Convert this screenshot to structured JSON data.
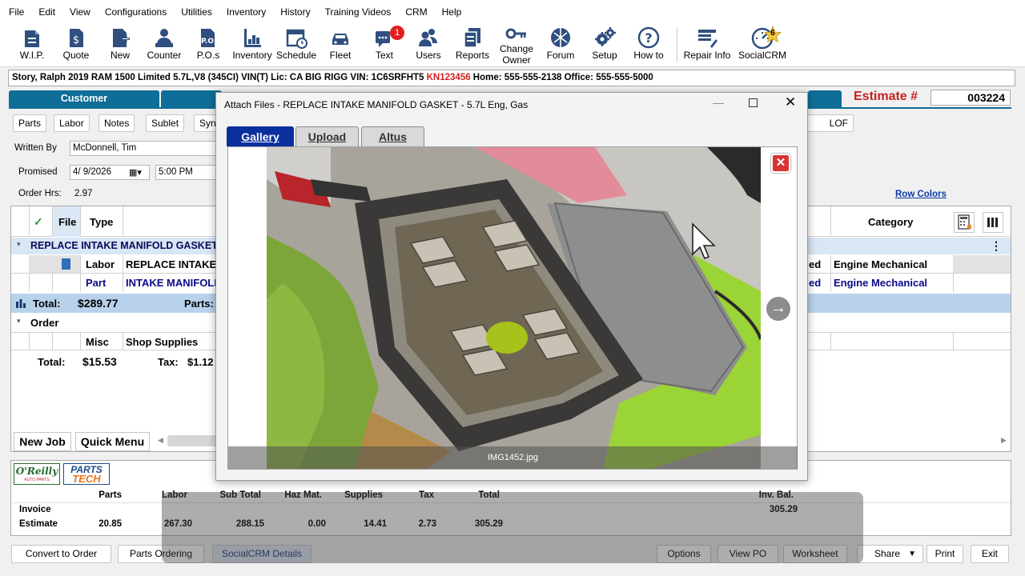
{
  "menu": [
    "File",
    "Edit",
    "View",
    "Configurations",
    "Utilities",
    "Inventory",
    "History",
    "Training Videos",
    "CRM",
    "Help"
  ],
  "toolbar": {
    "items": [
      {
        "label": "W.I.P.",
        "icon": "wip-icon"
      },
      {
        "label": "Quote",
        "icon": "quote-icon"
      },
      {
        "label": "New",
        "icon": "new-icon"
      },
      {
        "label": "Counter",
        "icon": "counter-icon"
      },
      {
        "label": "P.O.s",
        "icon": "po-icon"
      },
      {
        "label": "Inventory",
        "icon": "inventory-icon"
      },
      {
        "label": "Schedule",
        "icon": "schedule-icon"
      },
      {
        "label": "Fleet",
        "icon": "fleet-icon"
      },
      {
        "label": "Text",
        "icon": "text-icon"
      },
      {
        "label": "Users",
        "icon": "users-icon"
      },
      {
        "label": "Reports",
        "icon": "reports-icon"
      },
      {
        "label": "Change",
        "label2": "Owner",
        "icon": "change-owner-icon"
      },
      {
        "label": "Forum",
        "icon": "forum-icon"
      },
      {
        "label": "Setup",
        "icon": "setup-icon"
      },
      {
        "label": "How to",
        "icon": "how-to-icon"
      },
      {
        "label": "Repair Info",
        "icon": "repair-info-icon"
      },
      {
        "label": "SocialCRM",
        "icon": "socialcrm-icon"
      }
    ],
    "text_badge": "1",
    "socialcrm_badge": "6"
  },
  "customer_line": {
    "main": "Story, Ralph   2019  RAM 1500 Limited  5.7L,V8 (345CI) VIN(T) Lic: CA BIG RIGG  VIN: 1C6SRFHT5 ",
    "vin_tail": "KN123456",
    "phones": "  Home: 555-555-2138   Office: 555-555-5000"
  },
  "tabs": {
    "customer": "Customer"
  },
  "estimate": {
    "label": "Estimate #",
    "number": "003224"
  },
  "subtabs": [
    "Parts",
    "Labor",
    "Notes",
    "Sublet",
    "Syn"
  ],
  "lof": "LOF",
  "form": {
    "written_by_label": "Written By",
    "written_by": "McDonnell, Tim",
    "promised_label": "Promised",
    "promised_date": "4/  9/2026",
    "promised_time": "5:00 PM",
    "order_hrs_label": "Order Hrs:",
    "order_hrs": "2.97"
  },
  "row_colors": "Row Colors",
  "grid": {
    "headers": {
      "file": "File",
      "type": "Type",
      "category": "Category"
    },
    "job_title": "REPLACE INTAKE MANIFOLD GASKET",
    "lines": [
      {
        "type": "Labor",
        "desc": "REPLACE INTAKE M",
        "status": "ed",
        "category": "Engine Mechanical"
      },
      {
        "type": "Part",
        "desc": "INTAKE MANIFOLD",
        "status": "ed",
        "category": "Engine Mechanical"
      }
    ],
    "job_total_label": "Total:",
    "job_total": "$289.77",
    "job_parts_label": "Parts:",
    "order_group": "Order",
    "order_line": {
      "type": "Misc",
      "desc": "Shop Supplies"
    },
    "order_total_label": "Total:",
    "order_total": "$15.53",
    "order_tax_label": "Tax:",
    "order_tax": "$1.12",
    "new_job": "New Job",
    "quick_menu": "Quick Menu"
  },
  "modal": {
    "title": "Attach Files - REPLACE INTAKE MANIFOLD GASKET - 5.7L Eng,  Gas",
    "tabs": [
      "Gallery",
      "Upload",
      "Altus"
    ],
    "caption": "IMG1452.jpg"
  },
  "vendors": {
    "oreilly": "O'Reilly",
    "oreilly_sub": "AUTO PARTS",
    "partstech_1": "PARTS",
    "partstech_2": "TECH"
  },
  "totals": {
    "headers": [
      "Parts",
      "Labor",
      "Sub Total",
      "Haz Mat.",
      "Supplies",
      "Tax",
      "Total",
      "Inv. Bal."
    ],
    "invoice_label": "Invoice",
    "invoice_balance": "305.29",
    "estimate_label": "Estimate",
    "estimate_values": [
      "20.85",
      "267.30",
      "288.15",
      "0.00",
      "14.41",
      "2.73",
      "305.29"
    ]
  },
  "footer": {
    "convert": "Convert to Order",
    "parts_ordering": "Parts Ordering",
    "socialcrm": "SocialCRM Details",
    "options": "Options",
    "view_po": "View PO",
    "worksheet": "Worksheet",
    "share": "Share",
    "print": "Print",
    "exit": "Exit"
  },
  "colors": {
    "accent_blue": "#0e6e98",
    "gallery_tab": "#0b2f9c",
    "estimate_red": "#c81e1e",
    "group_row": "#d8e6f5",
    "close_red": "#d93333"
  }
}
